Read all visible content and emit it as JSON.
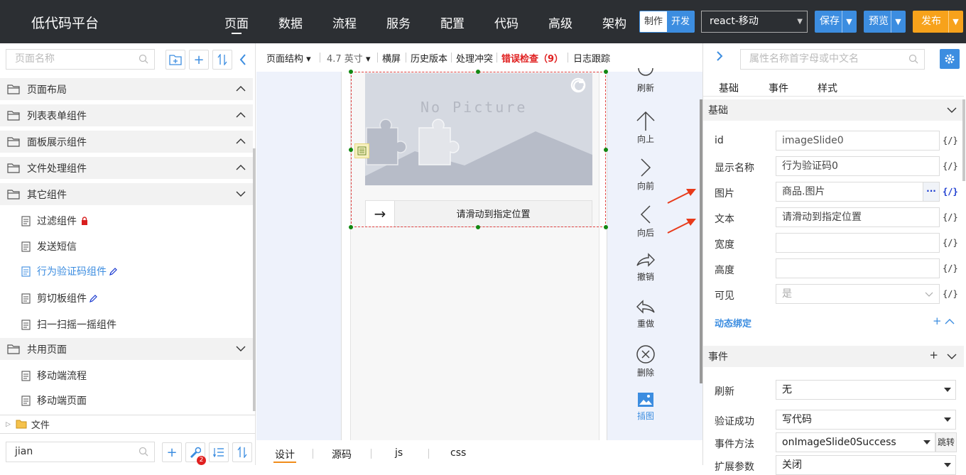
{
  "app": {
    "title": "低代码平台"
  },
  "nav": [
    "页面",
    "数据",
    "流程",
    "服务",
    "配置",
    "代码",
    "高级",
    "架构"
  ],
  "mode": {
    "make": "制作",
    "dev": "开发"
  },
  "framework": "react-移动",
  "actions": {
    "save": "保存",
    "preview": "预览",
    "publish": "发布"
  },
  "left": {
    "search_placeholder": "页面名称",
    "groups": [
      {
        "label": "页面布局",
        "state": "expanded"
      },
      {
        "label": "列表表单组件",
        "state": "expanded"
      },
      {
        "label": "面板展示组件",
        "state": "expanded"
      },
      {
        "label": "文件处理组件",
        "state": "expanded"
      },
      {
        "label": "其它组件",
        "state": "collapsed"
      }
    ],
    "items": [
      {
        "label": "过滤组件",
        "icon": "lock-icon"
      },
      {
        "label": "发送短信"
      },
      {
        "label": "行为验证码组件",
        "icon": "pencil-icon",
        "active": true
      },
      {
        "label": "剪切板组件",
        "icon": "pencil-icon"
      },
      {
        "label": "扫一扫摇一摇组件"
      }
    ],
    "shared_group": "共用页面",
    "shared_items": [
      "移动端流程",
      "移动端页面"
    ],
    "file_node": "文件",
    "bottom_search_value": "jian",
    "badge_count": "2"
  },
  "toolbar": {
    "structure": "页面结构",
    "size": "4.7 英寸",
    "landscape": "横屏",
    "history": "历史版本",
    "conflict": "处理冲突",
    "errors": "错误检查（9）",
    "logs": "日志跟踪"
  },
  "canvas": {
    "no_picture": "No Picture",
    "slide_hint": "请滑动到指定位置",
    "arrow": "→"
  },
  "side_tools": [
    "刷新",
    "向上",
    "向前",
    "向后",
    "撤销",
    "重做",
    "删除",
    "插图"
  ],
  "bottom_tabs": [
    "设计",
    "源码",
    "js",
    "css"
  ],
  "right": {
    "search_placeholder": "属性名称首字母或中文名",
    "tabs": [
      "基础",
      "事件",
      "样式"
    ],
    "basic_section": "基础",
    "props": [
      {
        "label": "id",
        "value": "imageSlide0",
        "code": "{/}"
      },
      {
        "label": "显示名称",
        "value": "行为验证码0",
        "code": "{/}"
      },
      {
        "label": "图片",
        "value": "商品.图片",
        "code": "{/}",
        "more": "···"
      },
      {
        "label": "文本",
        "value": "请滑动到指定位置",
        "code": "{/}"
      },
      {
        "label": "宽度",
        "value": "",
        "code": "{/}"
      },
      {
        "label": "高度",
        "value": "",
        "code": "{/}"
      },
      {
        "label": "可见",
        "value": "是",
        "code": "{/}"
      }
    ],
    "dynamic_binding": "动态绑定",
    "events_section": "事件",
    "events": [
      {
        "label": "刷新",
        "value": "无"
      },
      {
        "label": "验证成功",
        "value": "写代码"
      },
      {
        "label": "事件方法",
        "value": "onImageSlide0Success",
        "jump": "跳转"
      },
      {
        "label": "扩展参数",
        "value": "关闭"
      }
    ],
    "plus": "+"
  },
  "colors": {
    "accent": "#3c8de0",
    "publish": "#f7a21b",
    "error": "#e02020",
    "topbar": "#2c2f33"
  }
}
